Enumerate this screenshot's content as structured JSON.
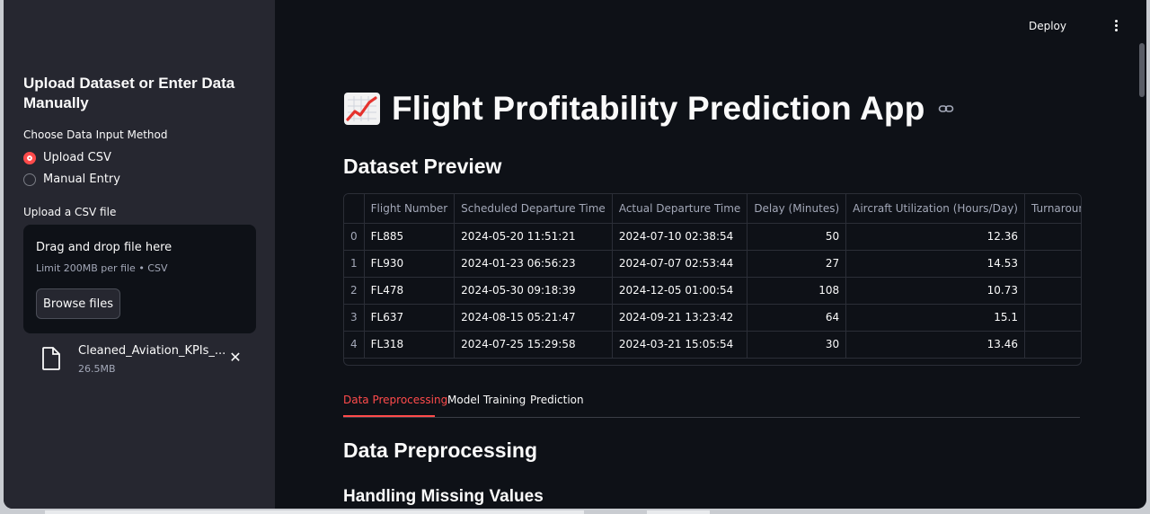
{
  "sidebar": {
    "title": "Upload Dataset or Enter Data Manually",
    "input_method_label": "Choose Data Input Method",
    "options": [
      {
        "label": "Upload CSV",
        "selected": true
      },
      {
        "label": "Manual Entry",
        "selected": false
      }
    ],
    "upload_label": "Upload a CSV file",
    "dropzone": {
      "title": "Drag and drop file here",
      "subtitle": "Limit 200MB per file • CSV",
      "browse_label": "Browse files"
    },
    "file": {
      "name": "Cleaned_Aviation_KPIs_...",
      "size": "26.5MB",
      "icon": "file-icon",
      "close_icon": "close-icon"
    }
  },
  "header": {
    "deploy_label": "Deploy",
    "menu_icon": "kebab-menu-icon"
  },
  "main": {
    "title": "Flight Profitability Prediction App",
    "title_icon": "chart-increasing-icon",
    "dataset_heading": "Dataset Preview",
    "table": {
      "columns": [
        "",
        "Flight Number",
        "Scheduled Departure Time",
        "Actual Departure Time",
        "Delay (Minutes)",
        "Aircraft Utilization (Hours/Day)",
        "Turnaround Time (Min"
      ],
      "rows": [
        [
          "0",
          "FL885",
          "2024-05-20 11:51:21",
          "2024-07-10 02:38:54",
          "50",
          "12.36",
          ""
        ],
        [
          "1",
          "FL930",
          "2024-01-23 06:56:23",
          "2024-07-07 02:53:44",
          "27",
          "14.53",
          ""
        ],
        [
          "2",
          "FL478",
          "2024-05-30 09:18:39",
          "2024-12-05 01:00:54",
          "108",
          "10.73",
          ""
        ],
        [
          "3",
          "FL637",
          "2024-08-15 05:21:47",
          "2024-09-21 13:23:42",
          "64",
          "15.1",
          ""
        ],
        [
          "4",
          "FL318",
          "2024-07-25 15:29:58",
          "2024-03-21 15:05:54",
          "30",
          "13.46",
          ""
        ]
      ]
    },
    "tabs": [
      {
        "label": "Data Preprocessing",
        "active": true
      },
      {
        "label": "Model Training",
        "active": false
      },
      {
        "label": "Prediction",
        "active": false
      }
    ],
    "section_heading": "Data Preprocessing",
    "subsection_heading": "Handling Missing Values"
  },
  "colors": {
    "accent": "#ff4b4b",
    "background": "#0e1117",
    "sidebar": "#262730"
  }
}
